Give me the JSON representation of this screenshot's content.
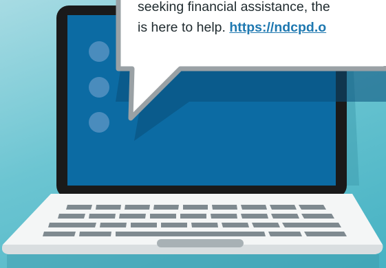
{
  "message": {
    "line_1": "seeking financial assistance, the",
    "line_2_text": "is here to help. ",
    "link_text": "https://ndcpd.o"
  },
  "colors": {
    "background": "#6cc5d2",
    "laptop_frame": "#1a1a1a",
    "screen": "#0c6ba3",
    "keyboard_base": "#f4f6f6",
    "keys": "#7f8a90",
    "bubble": "#ffffff",
    "bubble_border": "#9aa1a5",
    "link": "#1e78b0"
  },
  "icons": [
    "speech-bubble-icon",
    "laptop-icon",
    "dot-indicator-icon"
  ]
}
